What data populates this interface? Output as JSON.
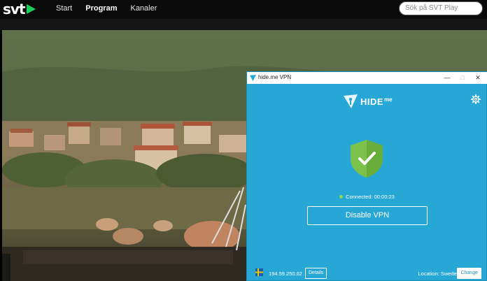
{
  "header": {
    "logo_text": "svt",
    "nav": [
      "Start",
      "Program",
      "Kanaler"
    ],
    "active_nav": "Program",
    "search_placeholder": "Sök på SVT Play"
  },
  "vpn": {
    "window_title": "hide.me VPN",
    "logo_text": "HIDE",
    "logo_suffix": "me",
    "status_text": "Connected: 00:00:23",
    "disable_label": "Disable VPN",
    "ip": "194.59.250.62",
    "details_label": "Details",
    "location_text": "Location: Sweden",
    "change_label": "Change",
    "colors": {
      "background": "#27a7d6",
      "shield": "#7cc24a",
      "status_dot": "#8bd94a"
    }
  }
}
